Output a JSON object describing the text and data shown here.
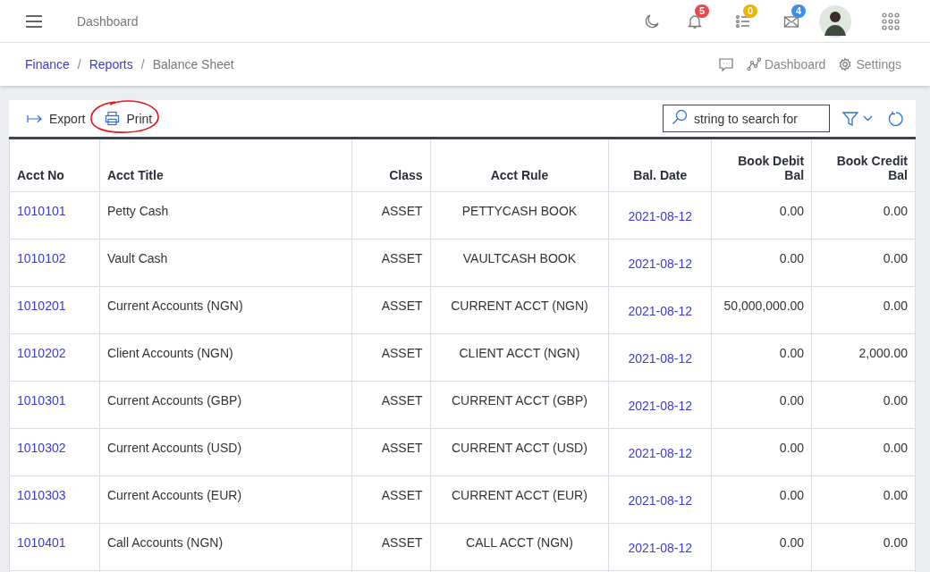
{
  "topbar": {
    "title": "Dashboard",
    "notifications": [
      {
        "kind": "bell",
        "count": "5",
        "color": "#e5484d"
      },
      {
        "kind": "list",
        "count": "0",
        "color": "#f0b400"
      },
      {
        "kind": "mail",
        "count": "4",
        "color": "#3b8ef0"
      }
    ]
  },
  "breadcrumbs": [
    {
      "label": "Finance",
      "link": true
    },
    {
      "separator": "/",
      "label": "Reports",
      "link": true
    },
    {
      "separator": "/",
      "label": "Balance Sheet",
      "link": false
    }
  ],
  "page_actions": [
    {
      "kind": "chat"
    },
    {
      "kind": "chart",
      "label": "Dashboard"
    },
    {
      "kind": "settings",
      "label": "Settings"
    }
  ],
  "toolbar": {
    "buttons": [
      {
        "kind": "export",
        "label": "Export",
        "circled": false
      },
      {
        "kind": "print",
        "label": "Print",
        "circled": true
      }
    ],
    "search": {
      "placeholder": "string to search for"
    }
  },
  "table": {
    "columns": [
      "Acct No",
      "Acct Title",
      "Class",
      "Acct Rule",
      "Bal. Date",
      "Book Debit Bal",
      "Book Credit Bal"
    ],
    "rows": [
      {
        "acct_no": "1010101",
        "title": "Petty Cash",
        "class": "ASSET",
        "rule": "PETTYCASH BOOK",
        "date": "2021-08-12",
        "debit": "0.00",
        "credit": "0.00"
      },
      {
        "acct_no": "1010102",
        "title": "Vault Cash",
        "class": "ASSET",
        "rule": "VAULTCASH BOOK",
        "date": "2021-08-12",
        "debit": "0.00",
        "credit": "0.00"
      },
      {
        "acct_no": "1010201",
        "title": "Current Accounts (NGN)",
        "class": "ASSET",
        "rule": "CURRENT ACCT (NGN)",
        "date": "2021-08-12",
        "debit": "50,000,000.00",
        "credit": "0.00"
      },
      {
        "acct_no": "1010202",
        "title": "Client Accounts (NGN)",
        "class": "ASSET",
        "rule": "CLIENT ACCT (NGN)",
        "date": "2021-08-12",
        "debit": "0.00",
        "credit": "2,000.00"
      },
      {
        "acct_no": "1010301",
        "title": "Current Accounts (GBP)",
        "class": "ASSET",
        "rule": "CURRENT ACCT (GBP)",
        "date": "2021-08-12",
        "debit": "0.00",
        "credit": "0.00"
      },
      {
        "acct_no": "1010302",
        "title": "Current Accounts (USD)",
        "class": "ASSET",
        "rule": "CURRENT ACCT (USD)",
        "date": "2021-08-12",
        "debit": "0.00",
        "credit": "0.00"
      },
      {
        "acct_no": "1010303",
        "title": "Current Accounts (EUR)",
        "class": "ASSET",
        "rule": "CURRENT ACCT (EUR)",
        "date": "2021-08-12",
        "debit": "0.00",
        "credit": "0.00"
      },
      {
        "acct_no": "1010401",
        "title": "Call Accounts (NGN)",
        "class": "ASSET",
        "rule": "CALL ACCT (NGN)",
        "date": "2021-08-12",
        "debit": "0.00",
        "credit": "0.00"
      }
    ]
  }
}
